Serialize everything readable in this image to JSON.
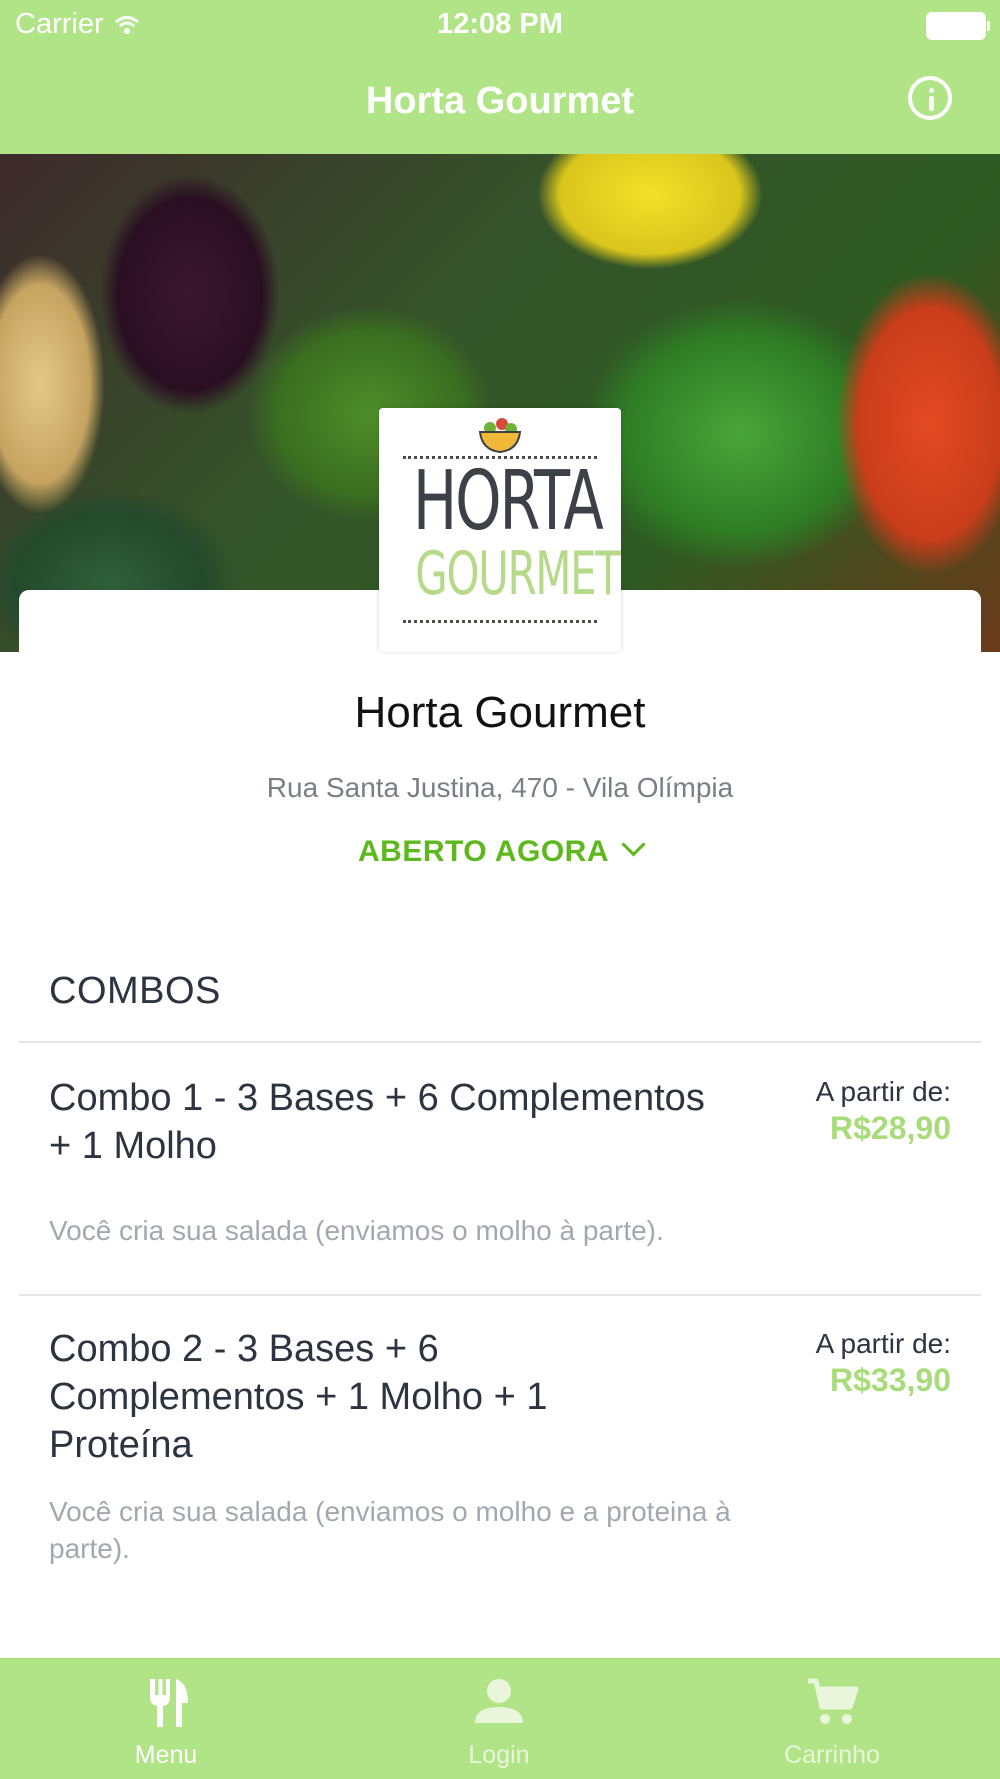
{
  "status_bar": {
    "carrier": "Carrier",
    "time": "12:08 PM"
  },
  "nav": {
    "title": "Horta Gourmet",
    "info_icon": "info-circle-icon"
  },
  "logo": {
    "line1": "HORTA",
    "line2": "GOURMET"
  },
  "restaurant": {
    "name": "Horta Gourmet",
    "address": "Rua Santa Justina, 470 - Vila Olímpia",
    "status": "ABERTO AGORA"
  },
  "section": {
    "title": "COMBOS"
  },
  "items": [
    {
      "title": "Combo 1 - 3 Bases + 6 Complementos + 1 Molho",
      "from_label": "A partir de:",
      "price": "R$28,90",
      "description": "Você cria sua salada (enviamos o molho à parte)."
    },
    {
      "title": "Combo 2 - 3 Bases + 6 Complementos + 1 Molho + 1 Proteína",
      "from_label": "A partir de:",
      "price": "R$33,90",
      "description": "Você cria sua salada (enviamos o molho e a proteina à parte)."
    }
  ],
  "tabbar": {
    "tabs": [
      {
        "label": "Menu",
        "icon": "fork-knife-icon",
        "active": true
      },
      {
        "label": "Login",
        "icon": "person-icon",
        "active": false
      },
      {
        "label": "Carrinho",
        "icon": "cart-icon",
        "active": false
      }
    ]
  },
  "colors": {
    "brand_green": "#b1e486",
    "open_green": "#5cb81c",
    "price_green": "#a8dc7a"
  }
}
